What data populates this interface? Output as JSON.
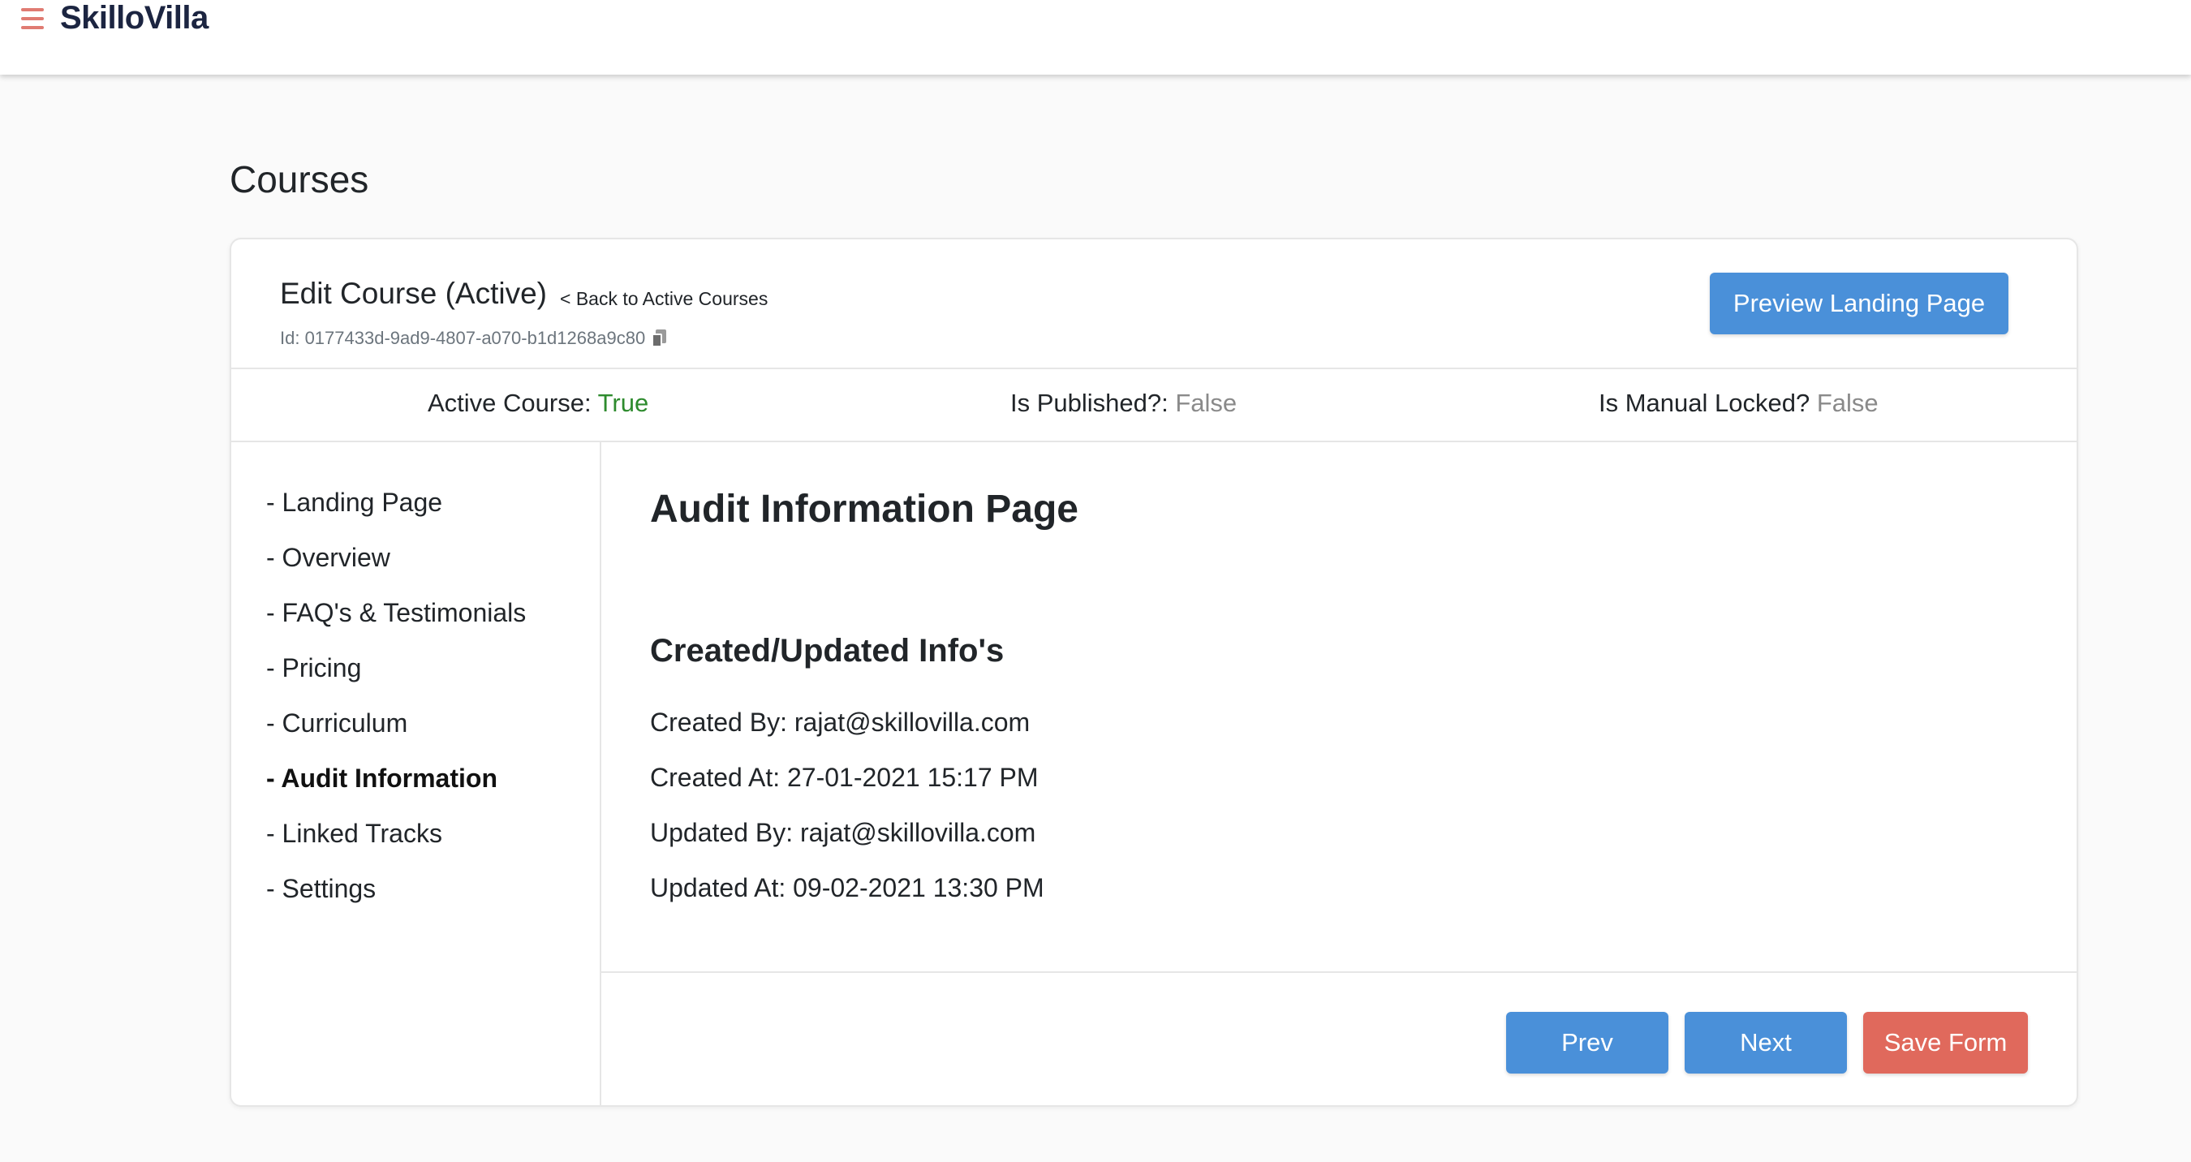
{
  "header": {
    "brand": "SkilloVilla"
  },
  "page": {
    "title": "Courses"
  },
  "course": {
    "edit_title": "Edit Course (Active)",
    "back_link": "< Back to Active Courses",
    "id_text": "Id: 0177433d-9ad9-4807-a070-b1d1268a9c80",
    "preview_button": "Preview Landing Page"
  },
  "status": {
    "active_label": "Active Course:",
    "active_value": "True",
    "published_label": "Is Published?:",
    "published_value": "False",
    "locked_label": "Is Manual Locked?",
    "locked_value": "False"
  },
  "sidebar": {
    "items": [
      {
        "label": "- Landing Page",
        "active": false
      },
      {
        "label": "- Overview",
        "active": false
      },
      {
        "label": "- FAQ's & Testimonials",
        "active": false
      },
      {
        "label": "- Pricing",
        "active": false
      },
      {
        "label": "- Curriculum",
        "active": false
      },
      {
        "label": "- Audit Information",
        "active": true
      },
      {
        "label": "- Linked Tracks",
        "active": false
      },
      {
        "label": "- Settings",
        "active": false
      }
    ]
  },
  "content": {
    "title": "Audit Information Page",
    "section_title": "Created/Updated Info's",
    "created_by": "Created By: rajat@skillovilla.com",
    "created_at": "Created At: 27-01-2021 15:17 PM",
    "updated_by": "Updated By: rajat@skillovilla.com",
    "updated_at": "Updated At: 09-02-2021 13:30 PM"
  },
  "footer": {
    "prev_label": "Prev",
    "next_label": "Next",
    "save_label": "Save Form"
  },
  "colors": {
    "primary": "#4a90d9",
    "danger": "#e0695c",
    "success": "#2e8b2e",
    "muted": "#8a8a8a"
  }
}
